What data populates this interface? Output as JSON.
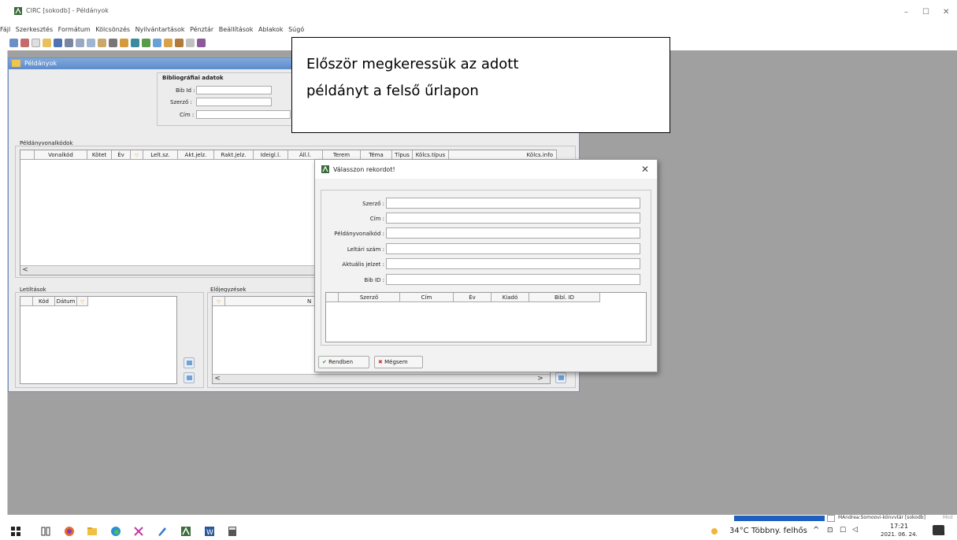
{
  "app": {
    "title": "CIRC [sokodb] - Példányok",
    "controls": {
      "minimize": "–",
      "maximize": "☐",
      "close": "✕"
    }
  },
  "menu": [
    "Fájl",
    "Szerkesztés",
    "Formátum",
    "Kölcsönzés",
    "Nyilvántartások",
    "Pénztár",
    "Beállítások",
    "Ablakok",
    "Súgó"
  ],
  "toolbar_icons": [
    "open-icon",
    "edit-icon",
    "new-icon",
    "folder-icon",
    "save-icon",
    "print-icon",
    "cut-icon",
    "copy-icon",
    "paste-icon",
    "tool-icon",
    "lend-icon",
    "return-icon",
    "reserve-icon",
    "card-icon",
    "user-icon",
    "users-icon",
    "help-icon",
    "book-icon"
  ],
  "peldanyok": {
    "title": "Példányok",
    "biblio_group": "Bibliográfiai adatok",
    "bib_id_label": "Bib Id :",
    "szerzo_label": "Szerző :",
    "cim_label": "Cím :",
    "vonalkodok_group": "Példányvonalkódok",
    "columns": [
      "Vonalkód",
      "Kötet",
      "Év",
      "Lelt.sz.",
      "Akt.jelz.",
      "Rakt.jelz.",
      "Ideigl.l.",
      "Áll.l.",
      "Terem",
      "Téma",
      "Típus",
      "Kölcs.típus",
      "Kölcs.info"
    ],
    "letiltasok_group": "Letiltások",
    "letiltasok_columns": [
      "Kód",
      "Dátum"
    ],
    "elojegyzesek_group": "Előjegyzések",
    "elojegyzesek_col": "N",
    "scroll_left": "<",
    "scroll_right": ">"
  },
  "callout": {
    "line1": "Először megkeressük az adott",
    "line2": "példányt a felső űrlapon"
  },
  "dialog": {
    "title": "Válasszon rekordot!",
    "close": "✕",
    "fields": [
      {
        "label": "Szerző :",
        "value": ""
      },
      {
        "label": "Cím :",
        "value": ""
      },
      {
        "label": "Példányvonalkód :",
        "value": ""
      },
      {
        "label": "Leltári szám :",
        "value": ""
      },
      {
        "label": "Aktuális jelzet :",
        "value": ""
      },
      {
        "label": "Bib ID :",
        "value": ""
      }
    ],
    "columns": [
      "Szerző",
      "Cím",
      "Év",
      "Kiadó",
      "Bibl. ID"
    ],
    "ok": "Rendben",
    "cancel": "Mégsem"
  },
  "statusbar": {
    "text": "MAndrea:Somoovi-könvvtár [sokodb]",
    "mode": "Mod"
  },
  "taskbar": {
    "weather": "34°C Többny. felhős",
    "time": "17:21",
    "date": "2021. 06. 24.",
    "notif": "4"
  }
}
